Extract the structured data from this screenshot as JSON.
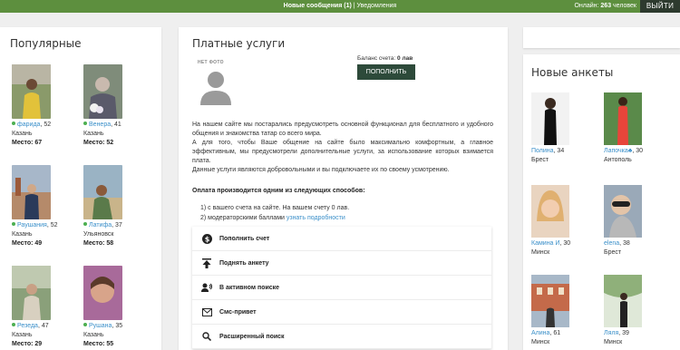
{
  "topbar": {
    "messages_label": "Новые сообщения (1)",
    "separator": " | ",
    "notifications_label": "Уведомления",
    "online_prefix": "Онлайн: ",
    "online_count": "263",
    "online_suffix": " человек",
    "exit_label": "ВЫЙТИ"
  },
  "popular": {
    "title": "Популярные",
    "people": [
      {
        "name": "фарида",
        "age": ", 52",
        "city": "Казань",
        "place": "Место: 67"
      },
      {
        "name": "Венера",
        "age": ", 41",
        "city": "Казань",
        "place": "Место: 52"
      },
      {
        "name": "Раушания",
        "age": ", 52",
        "city": "Казань",
        "place": "Место: 49"
      },
      {
        "name": "Латифа",
        "age": ", 37",
        "city": "Ульяновск",
        "place": "Место: 58"
      },
      {
        "name": "Резеда",
        "age": ", 47",
        "city": "Казань",
        "place": "Место: 29"
      },
      {
        "name": "Рушана",
        "age": ", 35",
        "city": "Казань",
        "place": "Место: 55"
      }
    ]
  },
  "paid": {
    "title": "Платные услуги",
    "no_photo": "НЕТ ФОТО",
    "balance_label": "Баланс счета: ",
    "balance_value": "0 лав",
    "topup_label": "ПОПОЛНИТЬ",
    "desc1": "На нашем сайте мы постарались предусмотреть основной функционал для бесплатного и удобного общения и знакомства татар со всего мира.",
    "desc2": "А для того, чтобы Ваше общение на сайте было максимально комфортным, а главное эффективным, мы предусмотрели дополнительные услуги, за использование которых взимается плата.",
    "desc3": "Данные услуги являются добровольными и вы подключаете их по своему усмотрению.",
    "pay_title": "Оплата производится одним из следующих способов:",
    "pay_option1": "1) с вашего счета на сайте. На вашем счету 0 лав.",
    "pay_option2": "2) модераторскими баллами ",
    "pay_option2_link": "узнать подробности",
    "menu": [
      {
        "label": "Пополнить счет",
        "icon": "dollar-icon"
      },
      {
        "label": "Поднять анкету",
        "icon": "upload-icon"
      },
      {
        "label": "В активном поиске",
        "icon": "people-icon"
      },
      {
        "label": "Смс-привет",
        "icon": "envelope-icon"
      },
      {
        "label": "Расширенный поиск",
        "icon": "search-icon"
      }
    ]
  },
  "new_profiles": {
    "title": "Новые анкеты",
    "people": [
      {
        "name": "Полина",
        "age": ", 34",
        "city": "Брест"
      },
      {
        "name": "Лапочка♣",
        "age": ", 30",
        "city": "Антополь"
      },
      {
        "name": "Камина И",
        "age": ", 30",
        "city": "Минск"
      },
      {
        "name": "elena",
        "age": ", 38",
        "city": "Брест"
      },
      {
        "name": "Алина",
        "age": ", 61",
        "city": "Минск"
      },
      {
        "name": "Ляля",
        "age": ", 39",
        "city": "Минск"
      }
    ]
  },
  "colors": {
    "topbar": "#5d8f3e",
    "accent_button": "#2d4a3a",
    "link": "#3a8fc9",
    "online_dot": "#4caf50"
  }
}
